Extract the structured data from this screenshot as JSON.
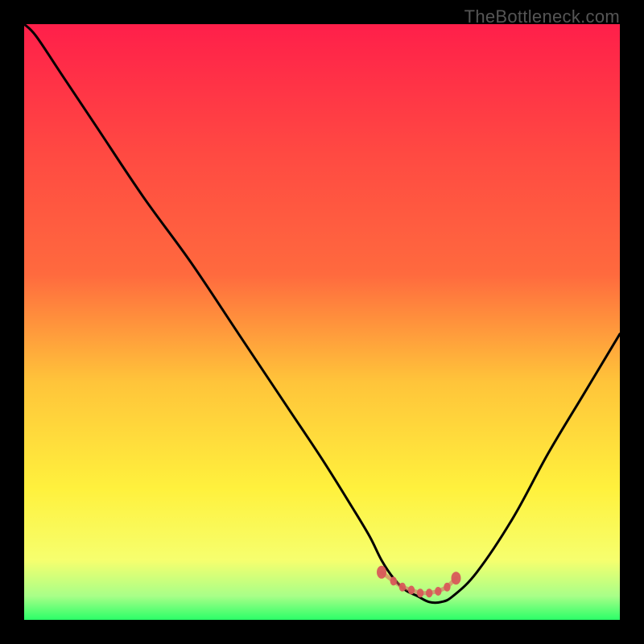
{
  "watermark": "TheBottleneck.com",
  "colors": {
    "black": "#000000",
    "curve": "#000000",
    "marker": "#d85a5a",
    "grad_top": "#ff1f4a",
    "grad_mid1": "#ff6a3e",
    "grad_mid2": "#ffc43a",
    "grad_mid3": "#fff13d",
    "grad_bot1": "#f6ff6e",
    "grad_bot2": "#a8ff88",
    "grad_bot3": "#2bff68"
  },
  "chart_data": {
    "type": "line",
    "title": "",
    "xlabel": "",
    "ylabel": "",
    "xlim": [
      0,
      100
    ],
    "ylim": [
      0,
      100
    ],
    "series": [
      {
        "name": "bottleneck-curve",
        "x": [
          0,
          2,
          6,
          12,
          20,
          28,
          36,
          44,
          50,
          55,
          58,
          60,
          62,
          64,
          66,
          68,
          70,
          72,
          76,
          82,
          88,
          94,
          100
        ],
        "values": [
          100,
          98,
          92,
          83,
          71,
          60,
          48,
          36,
          27,
          19,
          14,
          10,
          7,
          5,
          4,
          3,
          3,
          4,
          8,
          17,
          28,
          38,
          48
        ]
      }
    ],
    "markers": {
      "name": "optimal-range-markers",
      "x": [
        60.0,
        62.0,
        63.5,
        65.0,
        66.5,
        68.0,
        69.5,
        71.0,
        72.5
      ],
      "values": [
        8.0,
        6.5,
        5.5,
        5.0,
        4.5,
        4.5,
        4.8,
        5.5,
        7.0
      ]
    },
    "gradient_background": true
  }
}
